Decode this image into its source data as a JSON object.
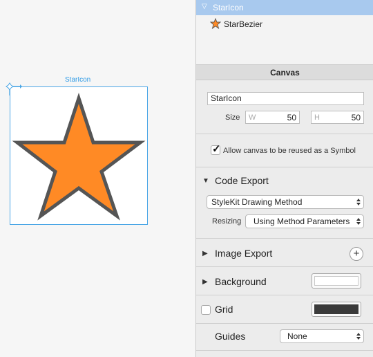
{
  "canvas": {
    "artboard_label": "StarIcon",
    "star_fill": "#ff8a25",
    "star_stroke": "#555555",
    "accent": "#4aa6e6"
  },
  "layers": {
    "selected": {
      "expand_glyph": "▽",
      "name": "StarIcon"
    },
    "child": {
      "icon": "star-icon",
      "name": "StarBezier"
    }
  },
  "canvas_section": {
    "title": "Canvas",
    "name_value": "StarIcon",
    "size_label": "Size",
    "width_placeholder": "W",
    "width_value": "50",
    "height_placeholder": "H",
    "height_value": "50",
    "reuse_label": "Allow canvas to be reused as a Symbol",
    "reuse_checked": true
  },
  "code_export": {
    "title": "Code Export",
    "method_value": "StyleKit Drawing Method",
    "resizing_label": "Resizing",
    "resizing_value": "Using Method Parameters"
  },
  "image_export": {
    "title": "Image Export",
    "add_glyph": "+"
  },
  "background": {
    "title": "Background",
    "color": "#ffffff"
  },
  "grid": {
    "title": "Grid",
    "checked": false,
    "color": "#3a3a3a"
  },
  "guides": {
    "title": "Guides",
    "value": "None"
  },
  "glyphs": {
    "collapsed": "▶",
    "expanded": "▼"
  }
}
